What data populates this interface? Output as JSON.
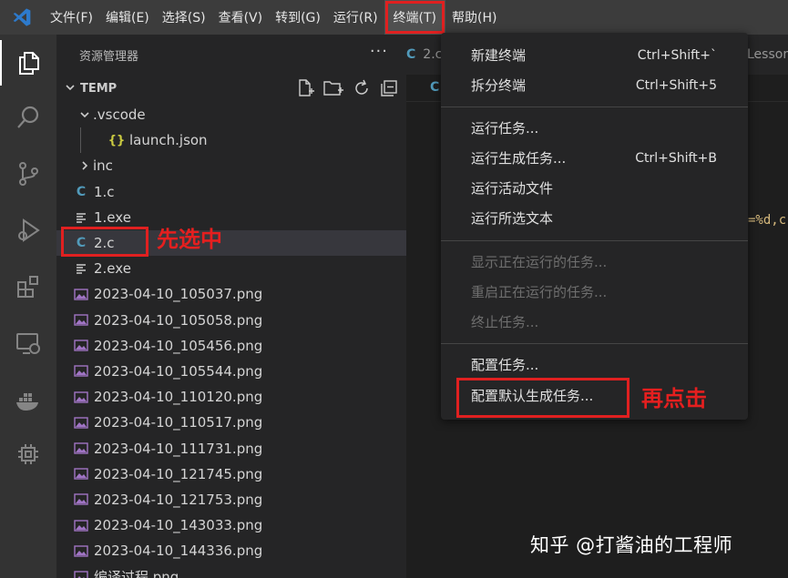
{
  "menubar": {
    "items": [
      "文件(F)",
      "编辑(E)",
      "选择(S)",
      "查看(V)",
      "转到(G)",
      "运行(R)",
      "终端(T)",
      "帮助(H)"
    ]
  },
  "explorer": {
    "title": "资源管理器",
    "more": "···",
    "root": "TEMP",
    "rows": [
      {
        "label": ".vscode",
        "icon": "chevron-down-icon"
      },
      {
        "label": "launch.json",
        "icon": "json-icon",
        "glyph": "{}"
      },
      {
        "label": "inc",
        "icon": "chevron-right-icon"
      },
      {
        "label": "1.c",
        "icon": "c-file-icon",
        "glyph": "C"
      },
      {
        "label": "1.exe",
        "icon": "file-lines-icon"
      },
      {
        "label": "2.c",
        "icon": "c-file-icon",
        "glyph": "C"
      },
      {
        "label": "2.exe",
        "icon": "file-lines-icon"
      },
      {
        "label": "2023-04-10_105037.png",
        "icon": "image-icon"
      },
      {
        "label": "2023-04-10_105058.png",
        "icon": "image-icon"
      },
      {
        "label": "2023-04-10_105456.png",
        "icon": "image-icon"
      },
      {
        "label": "2023-04-10_105544.png",
        "icon": "image-icon"
      },
      {
        "label": "2023-04-10_110120.png",
        "icon": "image-icon"
      },
      {
        "label": "2023-04-10_110517.png",
        "icon": "image-icon"
      },
      {
        "label": "2023-04-10_111731.png",
        "icon": "image-icon"
      },
      {
        "label": "2023-04-10_121745.png",
        "icon": "image-icon"
      },
      {
        "label": "2023-04-10_121753.png",
        "icon": "image-icon"
      },
      {
        "label": "2023-04-10_143033.png",
        "icon": "image-icon"
      },
      {
        "label": "2023-04-10_144336.png",
        "icon": "image-icon"
      },
      {
        "label": "编译过程.png",
        "icon": "image-icon"
      }
    ]
  },
  "editor": {
    "tab1_glyph": "C",
    "tab1_label": "2.c",
    "tab2_label": "Lessor",
    "breadcrumb_glyph": "C",
    "code_fragment": "=%d,c"
  },
  "terminal_menu": {
    "items": [
      {
        "label": "新建终端",
        "shortcut": "Ctrl+Shift+`",
        "enabled": true
      },
      {
        "label": "拆分终端",
        "shortcut": "Ctrl+Shift+5",
        "enabled": true
      },
      {
        "label": "运行任务...",
        "shortcut": "",
        "enabled": true
      },
      {
        "label": "运行生成任务...",
        "shortcut": "Ctrl+Shift+B",
        "enabled": true
      },
      {
        "label": "运行活动文件",
        "shortcut": "",
        "enabled": true
      },
      {
        "label": "运行所选文本",
        "shortcut": "",
        "enabled": true
      },
      {
        "label": "显示正在运行的任务...",
        "shortcut": "",
        "enabled": false
      },
      {
        "label": "重启正在运行的任务...",
        "shortcut": "",
        "enabled": false
      },
      {
        "label": "终止任务...",
        "shortcut": "",
        "enabled": false
      },
      {
        "label": "配置任务...",
        "shortcut": "",
        "enabled": true
      },
      {
        "label": "配置默认生成任务...",
        "shortcut": "",
        "enabled": true
      }
    ]
  },
  "annotations": {
    "step1": "先选中",
    "step2": "再点击"
  },
  "watermark": "知乎 @打酱油的工程师",
  "colors": {
    "highlight": "#e02020",
    "annotation": "#e51f1f",
    "c_icon": "#519aba",
    "json_icon": "#cbcb41",
    "image_icon": "#a074c4",
    "vscode_blue": "#2d7acc"
  }
}
